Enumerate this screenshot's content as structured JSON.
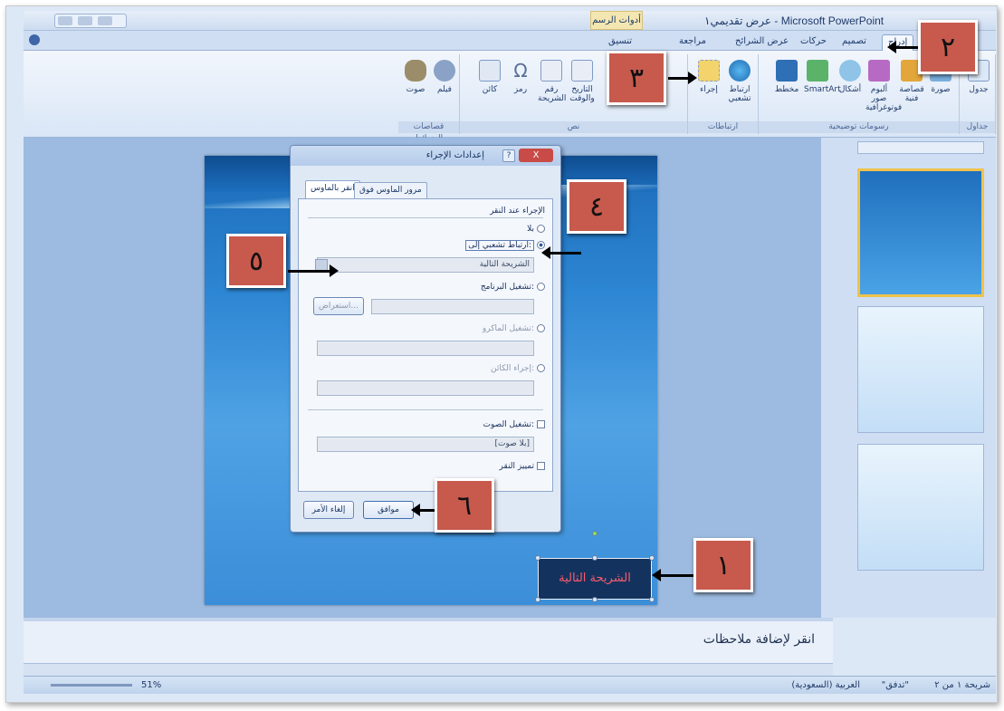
{
  "window": {
    "title": "عرض تقديمي١ - Microsoft PowerPoint",
    "contextual_tab": "أدوات الرسم"
  },
  "ribbon": {
    "tabs": [
      "إدراج",
      "تصميم",
      "حركات",
      "عرض الشرائح",
      "مراجعة",
      "تنسيق"
    ],
    "active_tab": "إدراج",
    "groups": {
      "tables": "جداول",
      "illustrations": "رسومات توضيحية",
      "links": "ارتباطات",
      "text": "نص",
      "media": "قصاصات الوسائط"
    },
    "buttons": {
      "table": "جدول",
      "picture": "صورة",
      "clipart": "قصاصة فنية",
      "album": "ألبوم صور فوتوغرافية",
      "shapes": "أشكال",
      "smartart": "SmartArt",
      "chart": "مخطط",
      "hyperlink": "ارتباط تشعبي",
      "action": "إجراء",
      "datetime": "التاريخ والوقت",
      "slidenum": "رقم الشريحة",
      "symbol": "رمز",
      "object": "كائن",
      "movie": "فيلم",
      "sound": "صوت"
    }
  },
  "dialog": {
    "title": "إعدادات الإجراء",
    "help": "?",
    "close": "X",
    "tabs": [
      "انقر بالماوس",
      "مرور الماوس فوق"
    ],
    "section_label": "الإجراء عند النقر",
    "options": {
      "none": "بلا",
      "hyperlink": "ارتباط تشعبي إلى:",
      "hyperlink_value": "الشريحة التالية",
      "run_program": "تشغيل البرنامج:",
      "browse": "استعراض...",
      "run_macro": "تشغيل الماكرو:",
      "object_action": "إجراء الكائن:"
    },
    "sound_label": "تشغيل الصوت:",
    "sound_value": "[بلا صوت]",
    "highlight_label": "تمييز النقر",
    "ok": "موافق",
    "cancel": "إلغاء الأمر"
  },
  "slide": {
    "shape_text": "الشريحة التالية"
  },
  "notes": {
    "placeholder": "انقر لإضافة ملاحظات"
  },
  "statusbar": {
    "slide_info": "شريحة ١ من ٢",
    "theme": "\"تدفق\"",
    "language": "العربية (السعودية)",
    "zoom": "51%"
  },
  "callouts": [
    "١",
    "٢",
    "٣",
    "٤",
    "٥",
    "٦"
  ],
  "colors": {
    "callout": "#c75a4d",
    "shape_fill": "#13335e",
    "shape_text": "#ff5a6e"
  }
}
